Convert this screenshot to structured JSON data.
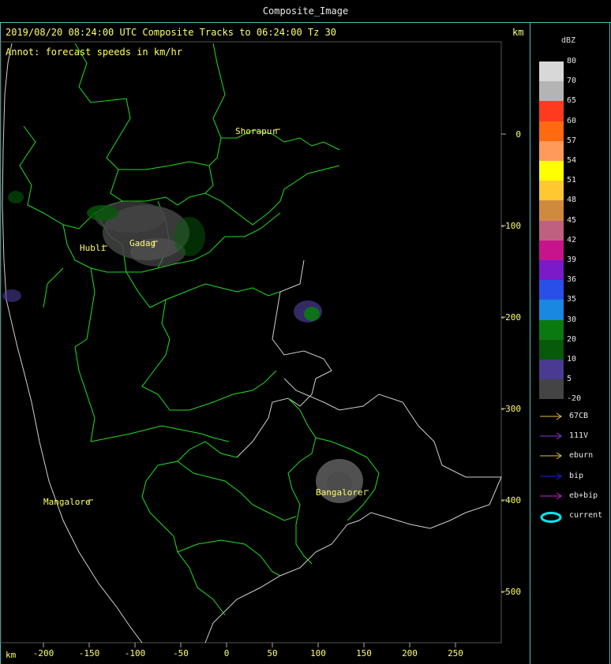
{
  "window": {
    "title": "Composite_Image"
  },
  "header": {
    "line": "2019/08/20 08:24:00 UTC Composite Tracks to 06:24:00 Tz 30",
    "annotation": "Annot: forecast speeds in km/hr",
    "km_top": "km",
    "km_bottom": "km"
  },
  "x_axis_ticks": [
    "-200",
    "-150",
    "-100",
    "-50",
    "0",
    "50",
    "100",
    "150",
    "200",
    "250"
  ],
  "y_axis_ticks": [
    "0",
    "-100",
    "-200",
    "-300",
    "-400",
    "-500"
  ],
  "cities": [
    "Shorapur",
    "Hubli",
    "Gadag",
    "Mangalore",
    "Bangalore"
  ],
  "legend": {
    "title": "dBZ",
    "levels": [
      {
        "label": "80",
        "color": "#d8d8d8"
      },
      {
        "label": "70",
        "color": "#b4b4b4"
      },
      {
        "label": "65",
        "color": "#ff3b1f"
      },
      {
        "label": "60",
        "color": "#ff6a10"
      },
      {
        "label": "57",
        "color": "#ff9a5a"
      },
      {
        "label": "54",
        "color": "#ffff00"
      },
      {
        "label": "51",
        "color": "#ffc830"
      },
      {
        "label": "48",
        "color": "#d08a40"
      },
      {
        "label": "45",
        "color": "#c06080"
      },
      {
        "label": "42",
        "color": "#c8148c"
      },
      {
        "label": "39",
        "color": "#7a1ac8"
      },
      {
        "label": "36",
        "color": "#2850e8"
      },
      {
        "label": "35",
        "color": "#1888e0"
      },
      {
        "label": "30",
        "color": "#0a7a10"
      },
      {
        "label": "20",
        "color": "#065a0a"
      },
      {
        "label": "10",
        "color": "#4a3a90"
      },
      {
        "label": "5",
        "color": "#444444"
      },
      {
        "label": "-20",
        "color": ""
      }
    ],
    "tracks": [
      {
        "label": "67CB",
        "color": "#e8c040"
      },
      {
        "label": "111V",
        "color": "#8a3ae0"
      },
      {
        "label": "eburn",
        "color": "#e8c040"
      },
      {
        "label": "bip",
        "color": "#2020e0"
      },
      {
        "label": "eb+bip",
        "color": "#d020d0"
      },
      {
        "label": "current",
        "color": "#00e8f0"
      }
    ]
  }
}
